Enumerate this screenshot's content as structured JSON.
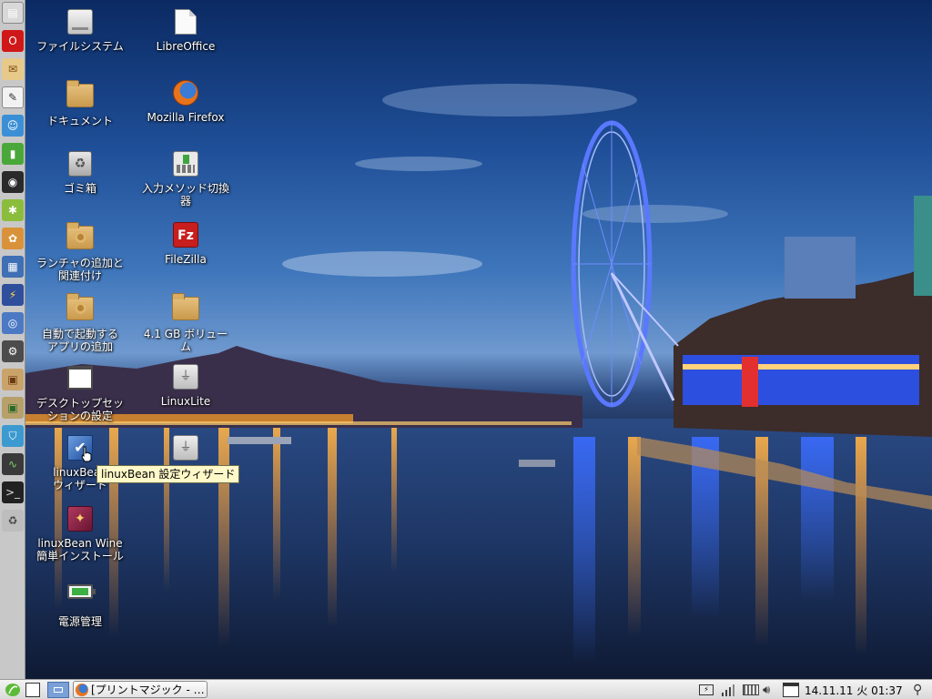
{
  "desktop": {
    "icons": [
      {
        "label": "ファイルシステム",
        "icon": "drive-icon"
      },
      {
        "label": "LibreOffice",
        "icon": "document-icon"
      },
      {
        "label": "ドキュメント",
        "icon": "folder-icon"
      },
      {
        "label": "Mozilla Firefox",
        "icon": "firefox-icon"
      },
      {
        "label": "ゴミ箱",
        "icon": "trash-icon"
      },
      {
        "label": "入力メソッド切換\n器",
        "icon": "keyboard-icon"
      },
      {
        "label": "ランチャの追加と\n関連付け",
        "icon": "folder-gear-icon"
      },
      {
        "label": "FileZilla",
        "icon": "filezilla-icon"
      },
      {
        "label": "自動で起動する\nアプリの追加",
        "icon": "folder-gear-icon"
      },
      {
        "label": "4.1 GB ボリュー\nム",
        "icon": "folder-icon"
      },
      {
        "label": "デスクトップセッ\nションの設定",
        "icon": "window-icon"
      },
      {
        "label": "LinuxLite",
        "icon": "usb-drive-icon"
      },
      {
        "label": "linuxBean\nウィザード",
        "icon": "wizard-icon"
      },
      {
        "label": "",
        "icon": "usb-drive-icon"
      },
      {
        "label": "linuxBean Wine\n簡単インストール",
        "icon": "wine-icon"
      },
      {
        "label": "電源管理",
        "icon": "battery-icon"
      }
    ]
  },
  "tooltip": {
    "text": "linuxBean 設定ウィザード"
  },
  "dock": {
    "items": [
      {
        "icon": "file-manager-icon",
        "color": "#d8d8d8"
      },
      {
        "icon": "opera-icon",
        "color": "#d01818"
      },
      {
        "icon": "mail-icon",
        "color": "#e7c98a"
      },
      {
        "icon": "text-editor-icon",
        "color": "#f2f2f2"
      },
      {
        "icon": "chat-icon",
        "color": "#3b8fd6"
      },
      {
        "icon": "notes-icon",
        "color": "#4aa83a"
      },
      {
        "icon": "media-player-icon",
        "color": "#2a2a2a"
      },
      {
        "icon": "bug-icon",
        "color": "#8bbd3c"
      },
      {
        "icon": "paint-icon",
        "color": "#d9923a"
      },
      {
        "icon": "image-viewer-icon",
        "color": "#3f6fb4"
      },
      {
        "icon": "lightning-icon",
        "color": "#2f4f9c"
      },
      {
        "icon": "network-icon",
        "color": "#4b79c4"
      },
      {
        "icon": "settings-icon",
        "color": "#4c4c4c"
      },
      {
        "icon": "package-icon",
        "color": "#c9a36a"
      },
      {
        "icon": "package-install-icon",
        "color": "#b7a06a"
      },
      {
        "icon": "store-icon",
        "color": "#3c9ad0"
      },
      {
        "icon": "system-monitor-icon",
        "color": "#3a3a3a"
      },
      {
        "icon": "terminal-icon",
        "color": "#222222"
      },
      {
        "icon": "trash-dock-icon",
        "color": "#bdbdbd"
      }
    ]
  },
  "taskbar": {
    "task_label": "[プリントマジック - …",
    "clock": "14.11.11 火 01:37"
  }
}
